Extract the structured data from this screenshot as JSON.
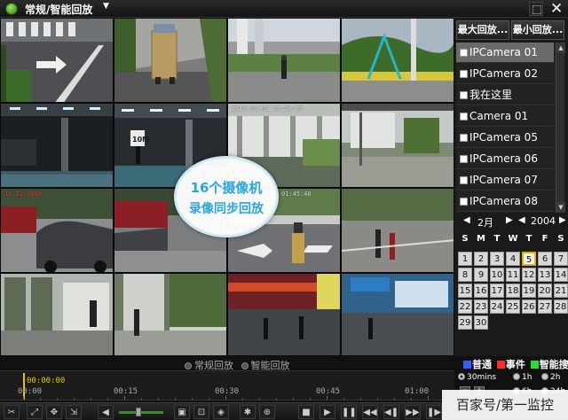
{
  "titlebar": {
    "mode_title": "常规/智能回放"
  },
  "grid": {
    "osd": {
      "cam6": "2018-04-02 15:59:57",
      "cam9": "11-22-2018",
      "cam11": "01:45:40"
    },
    "sign_text": "10M",
    "badge": {
      "line1": "16个摄像机",
      "line2": "录像同步回放"
    }
  },
  "panel": {
    "btn_max": "最大回放...",
    "btn_min": "最小回放...",
    "cameras": [
      {
        "label": "IPCamera 01",
        "selected": true
      },
      {
        "label": "IPCamera 02",
        "selected": false
      },
      {
        "label": "我在这里",
        "selected": false
      },
      {
        "label": "Camera 01",
        "selected": false
      },
      {
        "label": "IPCamera 05",
        "selected": false
      },
      {
        "label": "IPCamera 06",
        "selected": false
      },
      {
        "label": "IPCamera 07",
        "selected": false
      },
      {
        "label": "IPCamera 08",
        "selected": false
      }
    ],
    "scroll_up": "▲",
    "scroll_down": "▼"
  },
  "calendar": {
    "month": "2月",
    "year": "2004",
    "prev": "◀",
    "next": "▶",
    "weekdays": [
      "S",
      "M",
      "T",
      "W",
      "T",
      "F",
      "S"
    ],
    "days": [
      "1",
      "2",
      "3",
      "4",
      "5",
      "6",
      "7",
      "8",
      "9",
      "10",
      "11",
      "12",
      "13",
      "14",
      "15",
      "16",
      "17",
      "18",
      "19",
      "20",
      "21",
      "22",
      "23",
      "24",
      "25",
      "26",
      "27",
      "28",
      "29",
      "30"
    ],
    "selected_day": "5"
  },
  "bottom": {
    "mode_normal": "常规回放",
    "mode_smart": "智能回放",
    "legend": [
      {
        "label": "普通",
        "color": "#3b5bff"
      },
      {
        "label": "事件",
        "color": "#ff2a2a"
      },
      {
        "label": "智能搜索",
        "color": "#2ee02e"
      }
    ],
    "cursor_time": "00:00:00",
    "ticks": [
      "00:00",
      "00:15",
      "00:30",
      "00:45",
      "01:00"
    ],
    "zoom": [
      {
        "label": "30mins",
        "on": true
      },
      {
        "label": "1h",
        "on": false
      },
      {
        "label": "2h",
        "on": false
      },
      {
        "label": "6h",
        "on": false
      },
      {
        "label": "24h",
        "on": false
      }
    ],
    "zoom_minus": "−",
    "zoom_plus": "+"
  },
  "watermark": "百家号/第一监控"
}
